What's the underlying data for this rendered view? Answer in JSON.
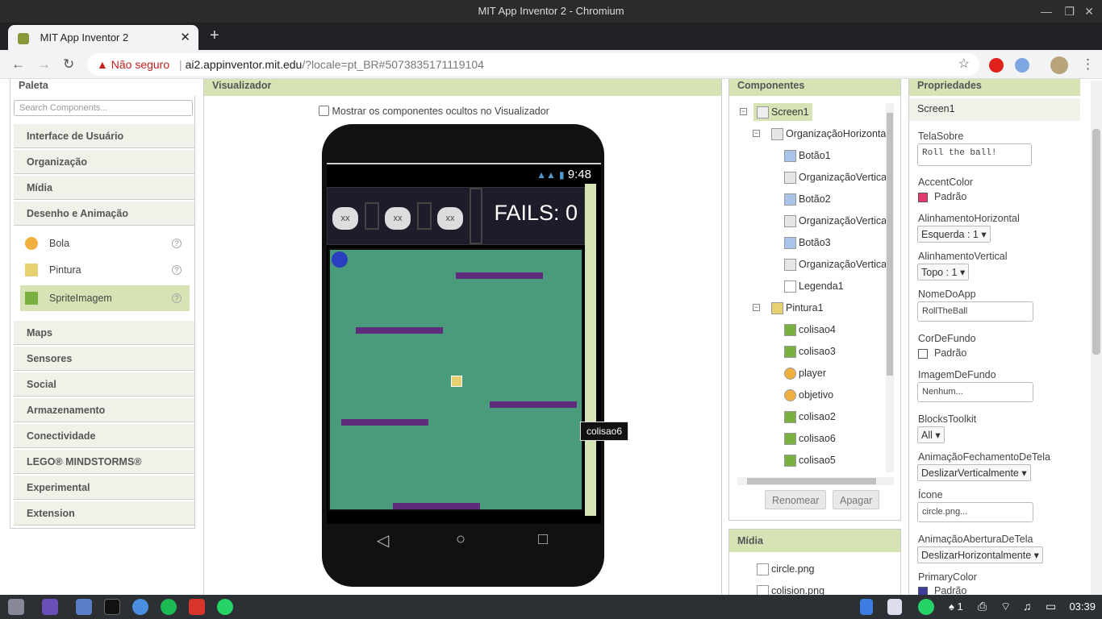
{
  "window": {
    "title": "MIT App Inventor 2 - Chromium"
  },
  "tab": {
    "title": "MIT App Inventor 2",
    "close": "✕",
    "new": "+"
  },
  "address": {
    "security_label": "Não seguro",
    "url_host": "ai2.appinventor.mit.edu",
    "url_rest": "/?locale=pt_BR#5073835171119104"
  },
  "palette": {
    "title": "Paleta",
    "search_placeholder": "Search Components...",
    "categories_top": [
      "Interface de Usuário",
      "Organização",
      "Mídia",
      "Desenho e Animação"
    ],
    "items": [
      {
        "label": "Bola"
      },
      {
        "label": "Pintura"
      },
      {
        "label": "SpriteImagem"
      }
    ],
    "categories_bottom": [
      "Maps",
      "Sensores",
      "Social",
      "Armazenamento",
      "Conectividade",
      "LEGO® MINDSTORMS®",
      "Experimental",
      "Extension"
    ]
  },
  "viewer": {
    "title": "Visualizador",
    "show_hidden": "Mostrar os componentes ocultos no Visualizador",
    "time": "9:48",
    "buttons": [
      "xx",
      "xx",
      "xx"
    ],
    "fails": "FAILS: 0",
    "tooltip": "colisao6"
  },
  "components": {
    "title": "Componentes",
    "tree": [
      "Screen1",
      "OrganizaçãoHorizontal",
      "Botão1",
      "OrganizaçãoVertica",
      "Botão2",
      "OrganizaçãoVertica",
      "Botão3",
      "OrganizaçãoVertica",
      "Legenda1",
      "Pintura1",
      "colisao4",
      "colisao3",
      "player",
      "objetivo",
      "colisao2",
      "colisao6",
      "colisao5"
    ],
    "rename": "Renomear",
    "delete": "Apagar"
  },
  "media": {
    "title": "Mídia",
    "files": [
      "circle.png",
      "colision.png"
    ]
  },
  "properties": {
    "title": "Propriedades",
    "component": "Screen1",
    "tela_sobre_label": "TelaSobre",
    "tela_sobre": "Roll the ball!",
    "accent_label": "AccentColor",
    "accent": "Padrão",
    "accent_color": "#e8366e",
    "alinh_h_label": "AlinhamentoHorizontal",
    "alinh_h": "Esquerda : 1 ▾",
    "alinh_v_label": "AlinhamentoVertical",
    "alinh_v": "Topo : 1 ▾",
    "nome_label": "NomeDoApp",
    "nome": "RollTheBall",
    "cor_label": "CorDeFundo",
    "cor": "Padrão",
    "img_label": "ImagemDeFundo",
    "img": "Nenhum...",
    "blocks_label": "BlocksToolkit",
    "blocks": "All ▾",
    "anim_fech_label": "AnimaçãoFechamentoDeTela",
    "anim_fech": "DeslizarVerticalmente ▾",
    "icone_label": "Ícone",
    "icone": "circle.png...",
    "anim_abert_label": "AnimaçãoAberturaDeTela",
    "anim_abert": "DeslizarHorizontalmente ▾",
    "primary_label": "PrimaryColor",
    "primary": "Padrão",
    "primary_color": "#3a3f9e"
  },
  "taskbar": {
    "clock": "03:39",
    "badge": "1"
  }
}
